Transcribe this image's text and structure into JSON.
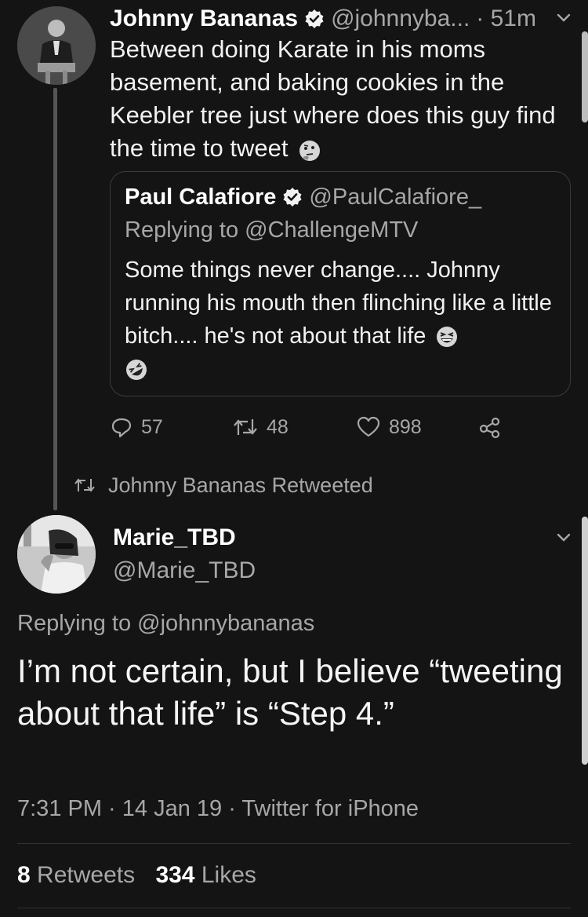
{
  "tweet": {
    "author_name": "Johnny Bananas",
    "author_handle": "@johnnyba...",
    "time_ago": "· 51m",
    "text": "Between doing Karate in his moms basement, and baking cookies in the Keebler tree just where does this guy find the time to tweet",
    "text_emoji": "thinking-face-icon",
    "quoted": {
      "author_name": "Paul Calafiore",
      "author_handle": "@PaulCalafiore_",
      "replying_to": "Replying to @ChallengeMTV",
      "text": "Some things never change.... Johnny running his mouth then flinching like a little bitch.... he's not about that life",
      "emojis": [
        "grinning-squinting-face-icon",
        "rolling-on-floor-laughing-icon"
      ]
    },
    "actions": {
      "reply_count": "57",
      "retweet_count": "48",
      "like_count": "898"
    }
  },
  "retweet_label": "Johnny Bananas Retweeted",
  "retweeted_tweet": {
    "author_name": "Marie_TBD",
    "author_handle": "@Marie_TBD",
    "replying_to": "Replying to @johnnybananas",
    "text": "I’m not certain, but I believe “tweeting about that life” is “Step 4.”",
    "timestamp": "7:31 PM · 14 Jan 19 · Twitter for iPhone",
    "retweets_count": "8",
    "retweets_label": "Retweets",
    "likes_count": "334",
    "likes_label": "Likes"
  },
  "colors": {
    "background": "#141414",
    "text_primary": "#f2f2f2",
    "text_muted": "#a7a7a7",
    "border": "#3b3b3b"
  }
}
